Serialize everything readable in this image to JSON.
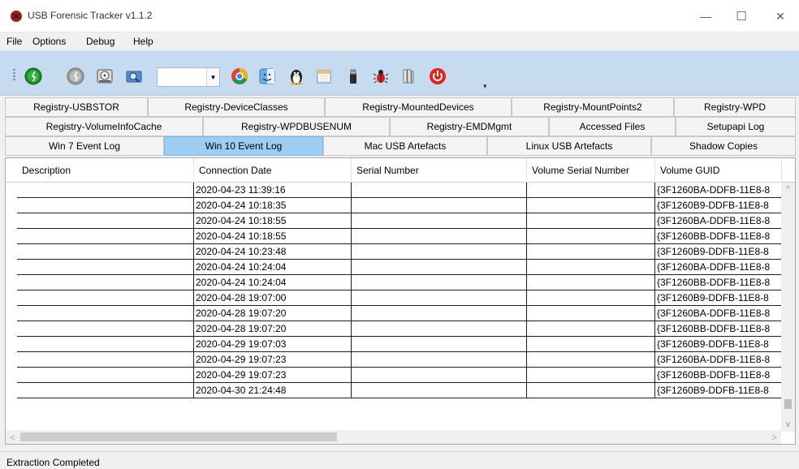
{
  "window": {
    "title": "USB Forensic Tracker v1.1.2",
    "minimize": "—",
    "maximize": "☐",
    "close": "✕"
  },
  "menu": {
    "items": [
      "File",
      "Options",
      "Debug",
      "Help"
    ]
  },
  "toolbar": {
    "combo_value": "",
    "combo_arrow": "▼",
    "overflow": "▾"
  },
  "tabs": {
    "row1": [
      "Registry-USBSTOR",
      "Registry-DeviceClasses",
      "Registry-MountedDevices",
      "Registry-MountPoints2",
      "Registry-WPD"
    ],
    "row2": [
      "Registry-VolumeInfoCache",
      "Registry-WPDBUSENUM",
      "Registry-EMDMgmt",
      "Accessed Files",
      "Setupapi Log"
    ],
    "row3": [
      "Win 7 Event Log",
      "Win 10 Event Log",
      "Mac USB Artefacts",
      "Linux USB Artefacts",
      "Shadow Copies"
    ],
    "active": "Win 10 Event Log"
  },
  "grid": {
    "columns": [
      "Description",
      "Connection Date",
      "Serial Number",
      "Volume Serial Number",
      "Volume GUID"
    ],
    "rows": [
      [
        "",
        "2020-04-23 11:39:16",
        "",
        "",
        "{3F1260BA-DDFB-11E8-8"
      ],
      [
        "",
        "2020-04-24 10:18:35",
        "",
        "",
        "{3F1260B9-DDFB-11E8-8"
      ],
      [
        "",
        "2020-04-24 10:18:55",
        "",
        "",
        "{3F1260BA-DDFB-11E8-8"
      ],
      [
        "",
        "2020-04-24 10:18:55",
        "",
        "",
        "{3F1260BB-DDFB-11E8-8"
      ],
      [
        "",
        "2020-04-24 10:23:48",
        "",
        "",
        "{3F1260B9-DDFB-11E8-8"
      ],
      [
        "",
        "2020-04-24 10:24:04",
        "",
        "",
        "{3F1260BA-DDFB-11E8-8"
      ],
      [
        "",
        "2020-04-24 10:24:04",
        "",
        "",
        "{3F1260BB-DDFB-11E8-8"
      ],
      [
        "",
        "2020-04-28 19:07:00",
        "",
        "",
        "{3F1260B9-DDFB-11E8-8"
      ],
      [
        "",
        "2020-04-28 19:07:20",
        "",
        "",
        "{3F1260BA-DDFB-11E8-8"
      ],
      [
        "",
        "2020-04-28 19:07:20",
        "",
        "",
        "{3F1260BB-DDFB-11E8-8"
      ],
      [
        "",
        "2020-04-29 19:07:03",
        "",
        "",
        "{3F1260B9-DDFB-11E8-8"
      ],
      [
        "",
        "2020-04-29 19:07:23",
        "",
        "",
        "{3F1260BA-DDFB-11E8-8"
      ],
      [
        "",
        "2020-04-29 19:07:23",
        "",
        "",
        "{3F1260BB-DDFB-11E8-8"
      ],
      [
        "",
        "2020-04-30 21:24:48",
        "",
        "",
        "{3F1260B9-DDFB-11E8-8"
      ]
    ]
  },
  "scroll": {
    "up": "^",
    "down": "v",
    "left": "<",
    "right": ">"
  },
  "status": {
    "text": "Extraction Completed"
  },
  "colors": {
    "toolbar_bg": "#c6daf0",
    "active_tab": "#9dcdf3"
  }
}
